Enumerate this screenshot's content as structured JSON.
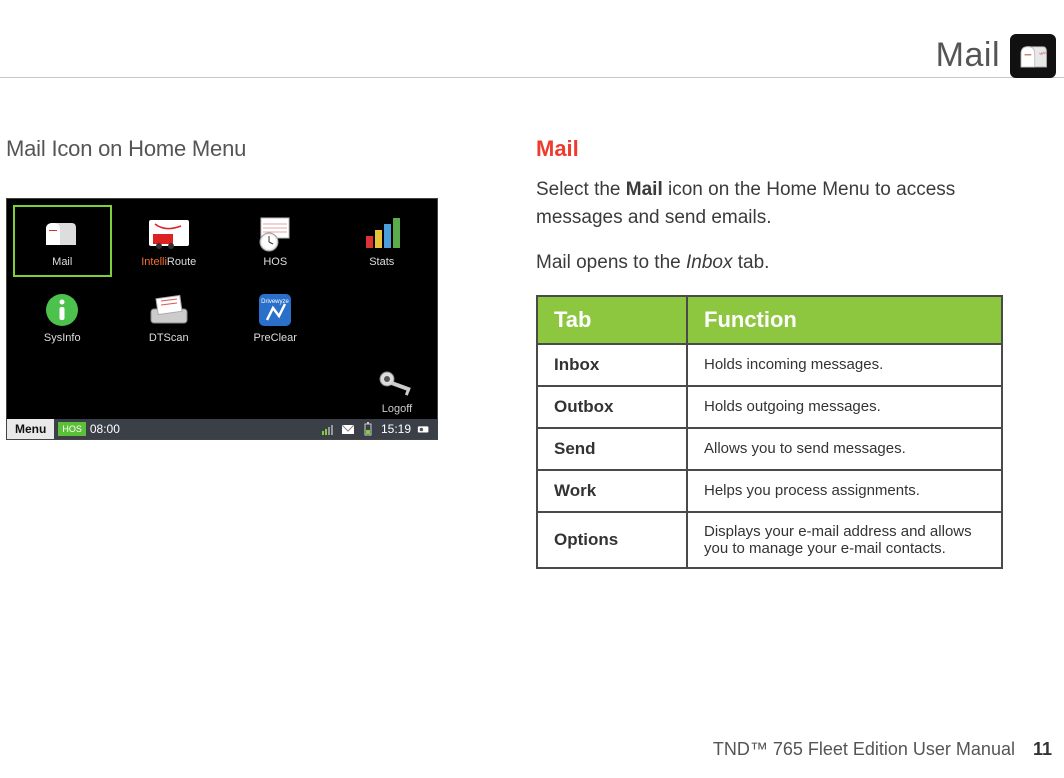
{
  "header": {
    "title": "Mail"
  },
  "left": {
    "caption": "Mail Icon on Home Menu",
    "menuItems": [
      {
        "label": "Mail",
        "selected": true
      },
      {
        "label": "IntelliRoute",
        "intelli": true
      },
      {
        "label": "HOS"
      },
      {
        "label": "Stats"
      },
      {
        "label": "SysInfo"
      },
      {
        "label": "DTScan"
      },
      {
        "label": "PreClear"
      }
    ],
    "logoffLabel": "Logoff",
    "statusBar": {
      "menu": "Menu",
      "hosTag": "HOS",
      "time1": "08:00",
      "time2": "15:19"
    }
  },
  "right": {
    "heading": "Mail",
    "p1_a": "Select the ",
    "p1_bold": "Mail",
    "p1_b": " icon on the Home Menu to access messages and send emails.",
    "p2_a": "Mail opens to the ",
    "p2_ital": "Inbox",
    "p2_b": " tab.",
    "tableHeader": {
      "c1": "Tab",
      "c2": "Function"
    },
    "rows": [
      {
        "tab": "Inbox",
        "fn": "Holds incoming messages."
      },
      {
        "tab": "Outbox",
        "fn": "Holds outgoing messages."
      },
      {
        "tab": "Send",
        "fn": "Allows you to send messages."
      },
      {
        "tab": "Work",
        "fn": "Helps you process assignments."
      },
      {
        "tab": "Options",
        "fn": "Displays your e-mail address and allows you to manage your e-mail contacts."
      }
    ]
  },
  "footer": {
    "doc": "TND™ 765 Fleet Edition User Manual",
    "page": "11"
  }
}
